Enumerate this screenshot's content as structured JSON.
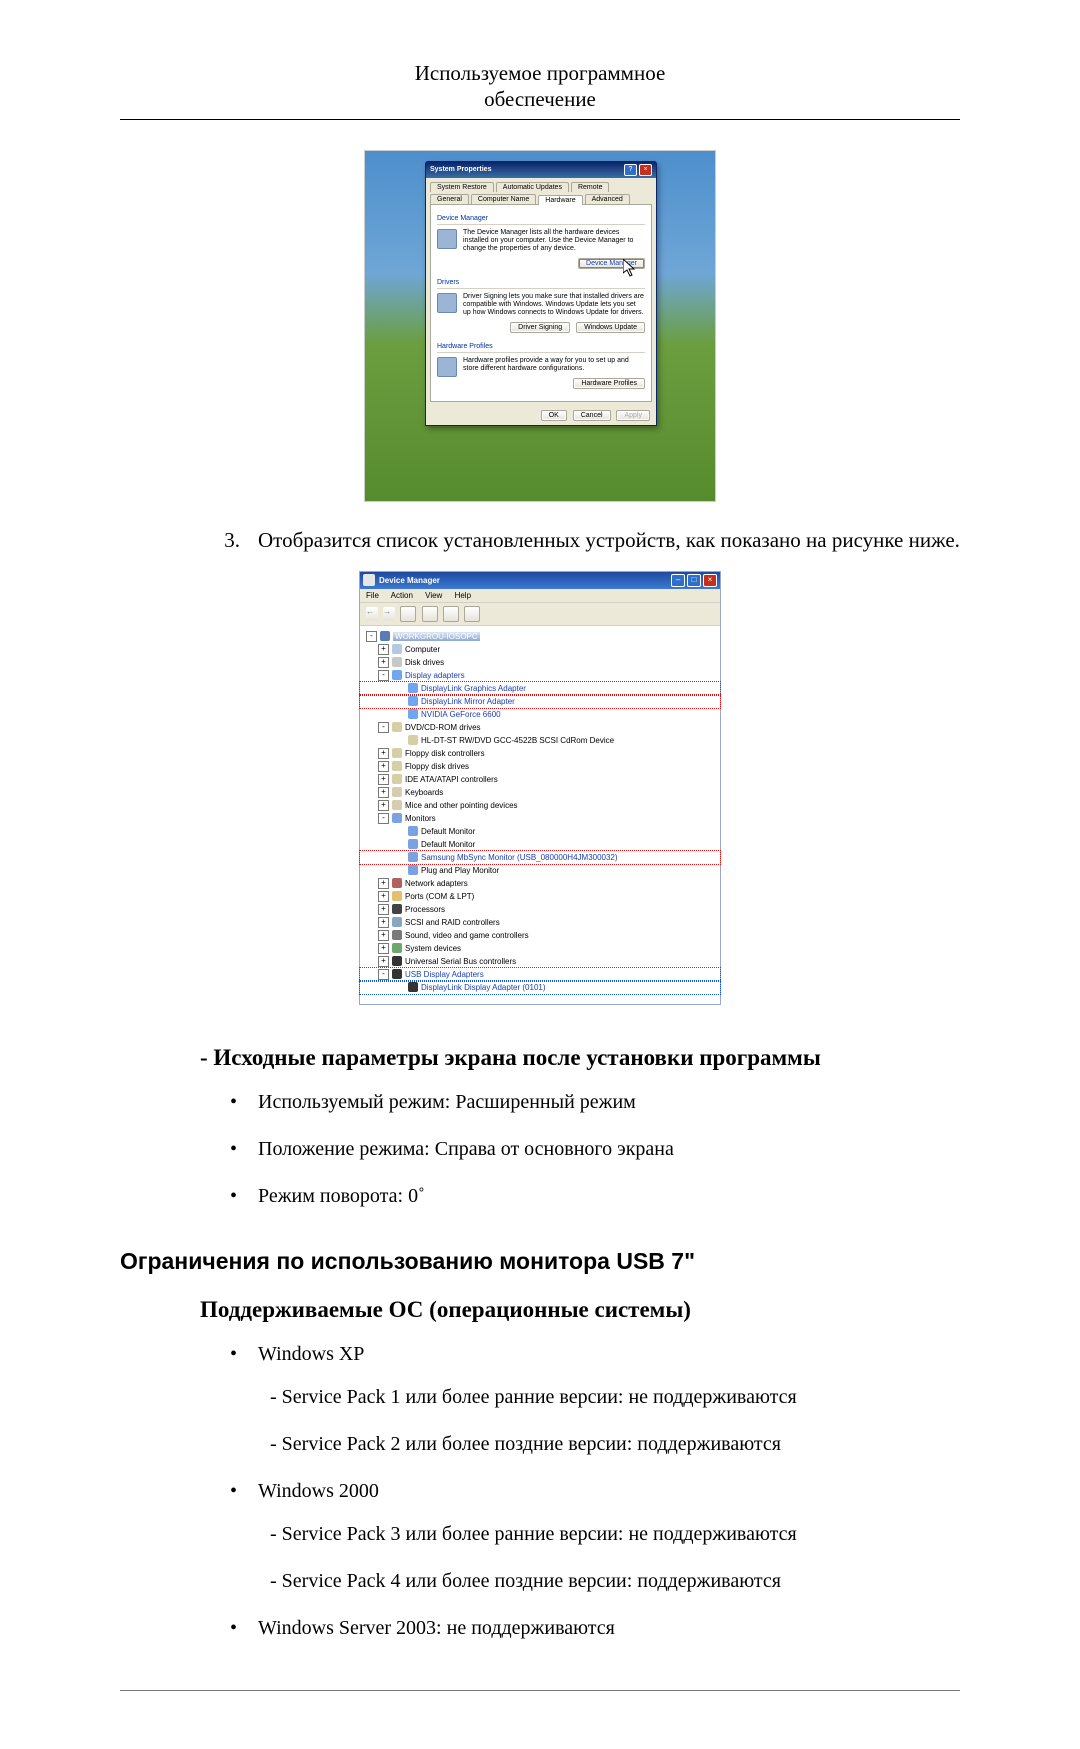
{
  "hdr": {
    "l1": "Используемое программное",
    "l2": "обеспечение"
  },
  "sysprop": {
    "title": "System Properties",
    "tabs_row1": [
      "System Restore",
      "Automatic Updates",
      "Remote"
    ],
    "tabs_row2": [
      "General",
      "Computer Name",
      "Hardware",
      "Advanced"
    ],
    "devmgr": {
      "heading": "Device Manager",
      "text": "The Device Manager lists all the hardware devices installed on your computer. Use the Device Manager to change the properties of any device.",
      "btn": "Device Manager"
    },
    "drivers": {
      "heading": "Drivers",
      "text": "Driver Signing lets you make sure that installed drivers are compatible with Windows. Windows Update lets you set up how Windows connects to Windows Update for drivers.",
      "btn1": "Driver Signing",
      "btn2": "Windows Update"
    },
    "hwprof": {
      "heading": "Hardware Profiles",
      "text": "Hardware profiles provide a way for you to set up and store different hardware configurations.",
      "btn": "Hardware Profiles"
    },
    "ok": "OK",
    "cancel": "Cancel",
    "apply": "Apply"
  },
  "step": {
    "n": "3.",
    "text": "Отобразится список установленных устройств, как показано на рисунке ниже."
  },
  "devmgr": {
    "title": "Device Manager",
    "menu": [
      "File",
      "Action",
      "View",
      "Help"
    ],
    "root": "WORKGROU-IOSOPC",
    "nodes": [
      {
        "pm": "+",
        "ico": "c-comp",
        "label": "Computer"
      },
      {
        "pm": "+",
        "ico": "c-disk",
        "label": "Disk drives"
      },
      {
        "pm": "-",
        "ico": "c-disp",
        "label": "Display adapters",
        "cls": "blue",
        "children": [
          {
            "ico": "c-disp",
            "label": "DisplayLink Graphics Adapter",
            "cls": "blue",
            "box": "hl-red"
          },
          {
            "ico": "c-disp",
            "label": "DisplayLink Mirror Adapter",
            "cls": "blue",
            "box": "hl-red"
          },
          {
            "ico": "c-disp",
            "label": "NVIDIA GeForce 6600",
            "cls": "blue"
          }
        ]
      },
      {
        "pm": "-",
        "ico": "c-cd",
        "label": "DVD/CD-ROM drives",
        "children": [
          {
            "ico": "c-cd",
            "label": "HL-DT-ST RW/DVD GCC-4522B SCSI CdRom Device"
          }
        ]
      },
      {
        "pm": "+",
        "ico": "c-cd",
        "label": "Floppy disk controllers"
      },
      {
        "pm": "+",
        "ico": "c-cd",
        "label": "Floppy disk drives"
      },
      {
        "pm": "+",
        "ico": "c-cd",
        "label": "IDE ATA/ATAPI controllers"
      },
      {
        "pm": "+",
        "ico": "c-kb",
        "label": "Keyboards"
      },
      {
        "pm": "+",
        "ico": "c-kb",
        "label": "Mice and other pointing devices"
      },
      {
        "pm": "-",
        "ico": "c-mon",
        "label": "Monitors",
        "children": [
          {
            "ico": "c-mon",
            "label": "Default Monitor"
          },
          {
            "ico": "c-mon",
            "label": "Default Monitor"
          },
          {
            "ico": "c-mon",
            "label": "Samsung MbSync Monitor (USB_080000H4JM300032)",
            "cls": "blue",
            "box": "hl-red"
          },
          {
            "ico": "c-mon",
            "label": "Plug and Play Monitor"
          }
        ]
      },
      {
        "pm": "+",
        "ico": "c-net",
        "label": "Network adapters"
      },
      {
        "pm": "+",
        "ico": "c-port",
        "label": "Ports (COM & LPT)"
      },
      {
        "pm": "+",
        "ico": "c-cpu",
        "label": "Processors"
      },
      {
        "pm": "+",
        "ico": "c-scsi",
        "label": "SCSI and RAID controllers"
      },
      {
        "pm": "+",
        "ico": "c-snd",
        "label": "Sound, video and game controllers"
      },
      {
        "pm": "+",
        "ico": "c-sys",
        "label": "System devices"
      },
      {
        "pm": "+",
        "ico": "c-usb",
        "label": "Universal Serial Bus controllers"
      },
      {
        "pm": "-",
        "ico": "c-usb",
        "label": "USB Display Adapters",
        "cls": "blue",
        "box": "hl-blue",
        "children": [
          {
            "ico": "c-usb",
            "label": "DisplayLink Display Adapter (0101)",
            "cls": "blue",
            "box": "hl-blue"
          }
        ]
      }
    ]
  },
  "initial": {
    "heading": "- Исходные параметры экрана после установки программы",
    "items": [
      "Используемый режим: Расширенный режим",
      "Положение режима: Справа от основного экрана",
      "Режим поворота: 0˚"
    ]
  },
  "limits": {
    "heading": "Ограничения по использованию монитора USB 7\"",
    "os_heading": "Поддерживаемые ОС (операционные системы)",
    "os": [
      {
        "name": "Windows XP",
        "sub": [
          "- Service Pack 1 или более ранние версии: не поддерживаются",
          "- Service Pack 2 или более поздние версии: поддерживаются"
        ]
      },
      {
        "name": "Windows 2000",
        "sub": [
          "- Service Pack 3 или более ранние версии: не поддерживаются",
          "- Service Pack 4 или более поздние версии: поддерживаются"
        ]
      },
      {
        "name": "Windows Server 2003: не поддерживаются"
      }
    ]
  }
}
